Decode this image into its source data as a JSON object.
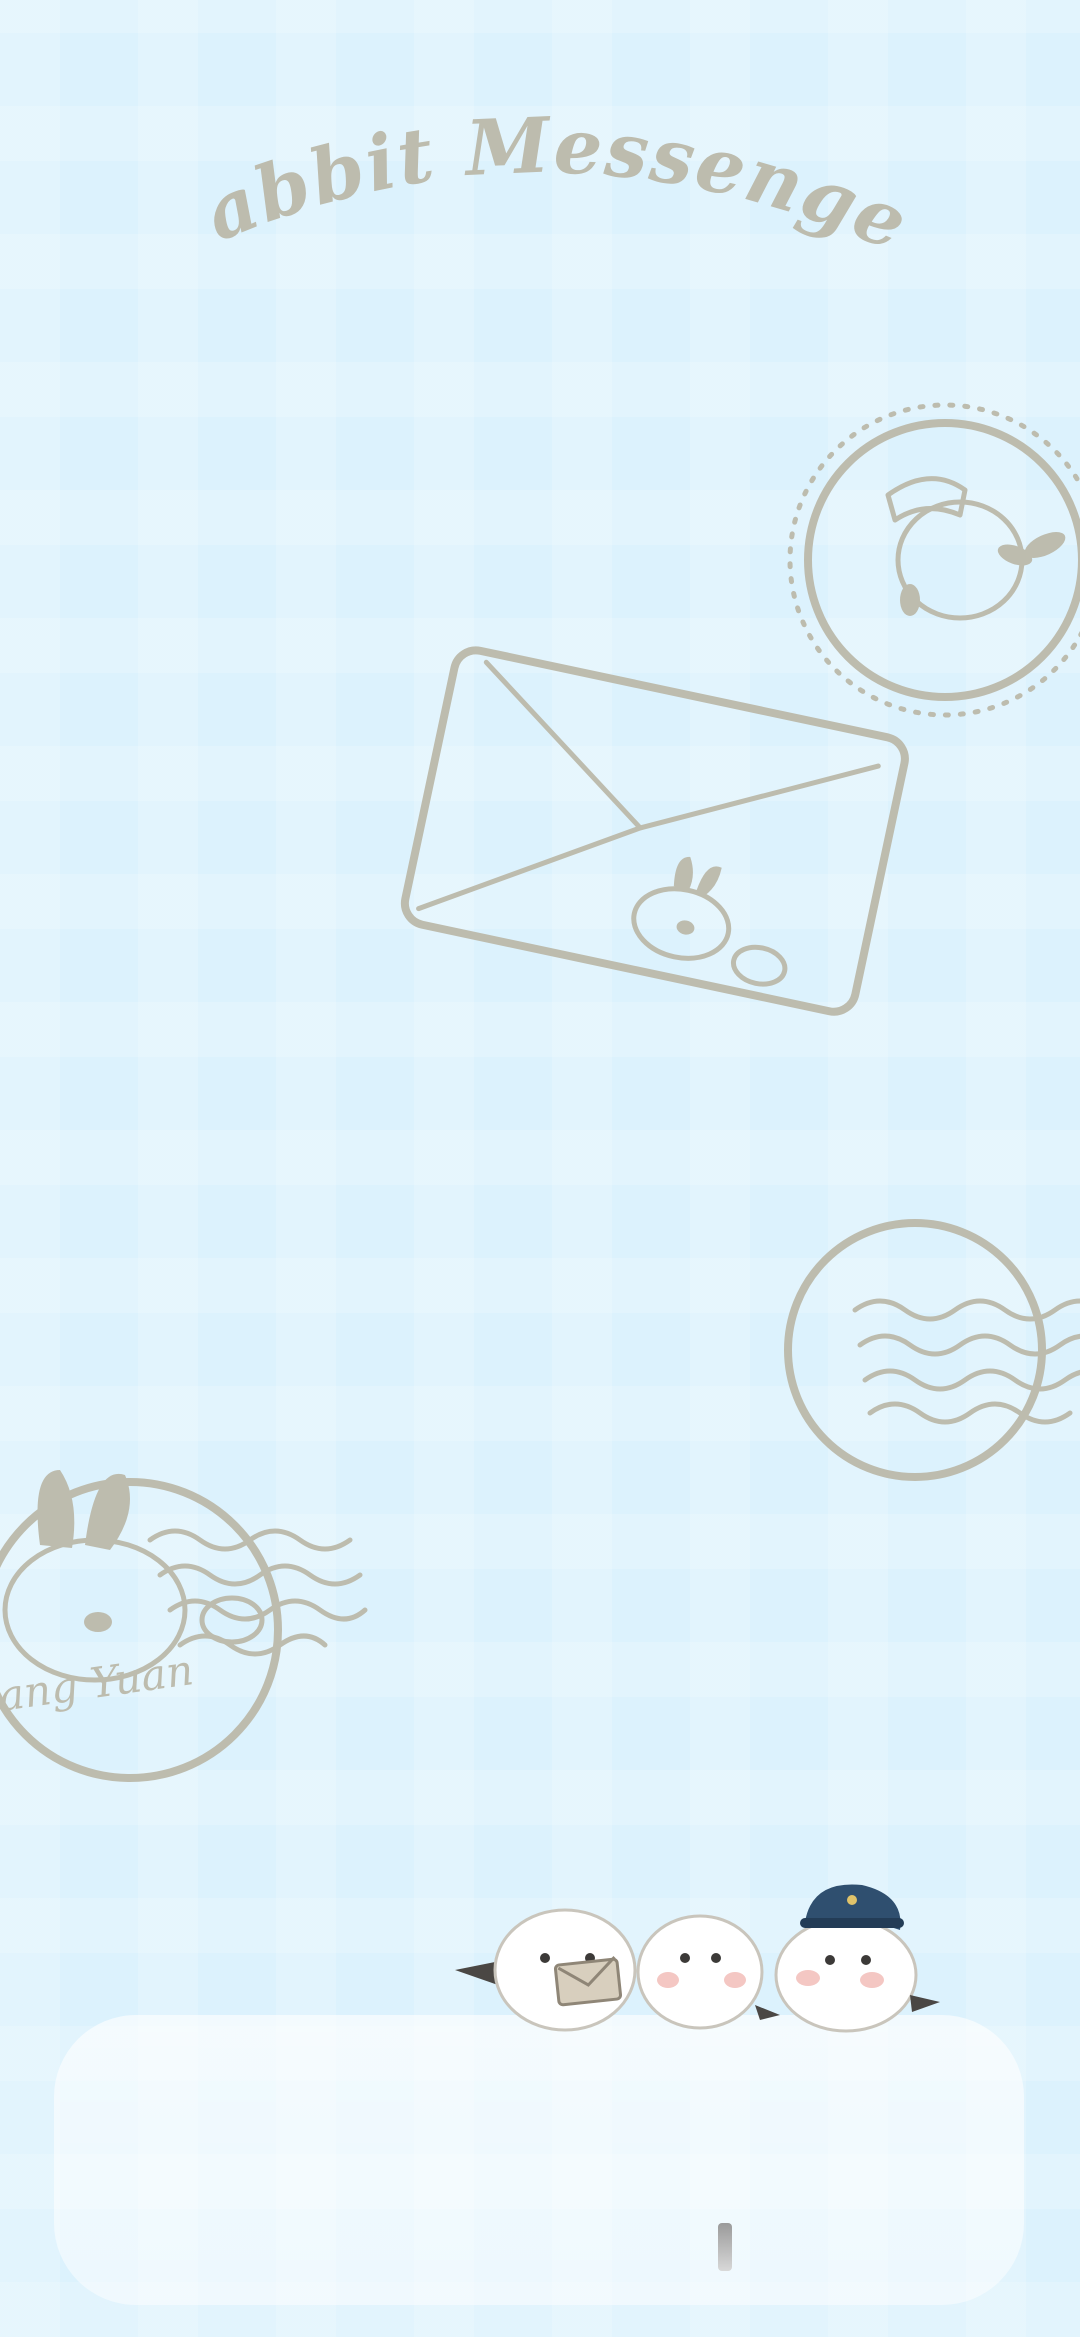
{
  "wallpaper": {
    "title": "Rabbit Messenger",
    "stamp_caption": "ang Yuan",
    "icons": [
      "rabbit-postman-stamp-icon",
      "envelope-rabbit-icon",
      "postmark-icon",
      "rabbit-stamp-icon",
      "three-birds-icon"
    ],
    "colors": {
      "background": "#dcf2fd",
      "sketch": "#bdbcae",
      "dock": "#ffffff",
      "postman_hat": "#2f4f6f"
    }
  }
}
